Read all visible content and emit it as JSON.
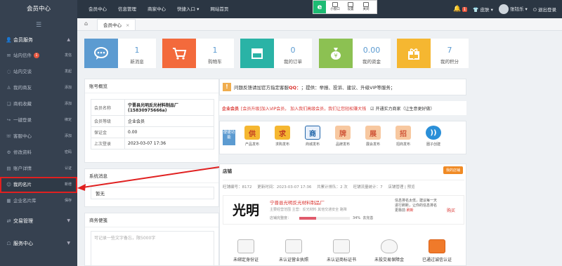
{
  "topbar": {
    "brand": "会员中心",
    "nav": [
      "会员中心",
      "信息管理",
      "商家中心",
      "快捷入口",
      "网站首页"
    ],
    "nav_dropdown_icon": "caret-down-icon",
    "floater": [
      "小窗口",
      "设置",
      "关闭"
    ],
    "notif_count": "1",
    "skin": "皮肤",
    "username": "张钰乐",
    "logout": "退出登录"
  },
  "sidebar": {
    "section": "会员服务",
    "items": [
      {
        "label": "站内信件",
        "badge": "1",
        "action": "发信"
      },
      {
        "label": "站内交谈",
        "action": "发起"
      },
      {
        "label": "我的商友",
        "action": "添加"
      },
      {
        "label": "商机收藏",
        "action": "添加"
      },
      {
        "label": "一键登录",
        "action": "绑定"
      },
      {
        "label": "客服中心",
        "action": "添加"
      },
      {
        "label": "修改资料",
        "action": "密码"
      },
      {
        "label": "账户详情",
        "action": "认证"
      },
      {
        "label": "我的名片",
        "action": "新增"
      },
      {
        "label": "企业名片库",
        "action": "保存"
      }
    ],
    "groups": [
      "交易管理",
      "服务中心"
    ]
  },
  "tabs": {
    "home_icon": "home-icon",
    "active": "会员中心"
  },
  "stats": [
    {
      "value": "1",
      "label": "新消息",
      "color": "#5c9bd1",
      "icon": "chat-icon"
    },
    {
      "value": "1",
      "label": "购物车",
      "color": "#f36a3c",
      "icon": "cart-icon"
    },
    {
      "value": "0",
      "label": "我的订单",
      "color": "#2ab3a6",
      "icon": "store-icon"
    },
    {
      "value": "0.00",
      "label": "我的资金",
      "color": "#8cc152",
      "icon": "money-icon"
    },
    {
      "value": "7",
      "label": "我的积分",
      "color": "#f5b731",
      "icon": "gift-icon"
    }
  ],
  "account": {
    "title": "账号概览",
    "rows": [
      {
        "k": "会员名称",
        "v": "宁晋县光明反光材料制品厂 (15830975666a)"
      },
      {
        "k": "会员等级",
        "v": "企业会员"
      },
      {
        "k": "保证金",
        "v": "0.00"
      },
      {
        "k": "上次登录",
        "v": "2023-03-07 17:36"
      }
    ]
  },
  "system": {
    "title": "系统消息",
    "empty": "暂无"
  },
  "memo": {
    "title": "商务便笺",
    "placeholder": "可记录一些文字备忘，限5000字"
  },
  "notice": {
    "pre": "问题反馈请加官方指定客服",
    "qq": "QQ：",
    "post": "；提供：举报、投诉、建议、升级VIP等服务；"
  },
  "upsell": {
    "title": "企业会员",
    "pre": "[会员升级]",
    "join": "加入VIP会员，",
    "mid": "加入我们高级会员，我们让您轻松赚大钱",
    "strength": "开通实力商家（让生意更好做）"
  },
  "tools": {
    "label": "便捷功能",
    "items": [
      {
        "char": "供",
        "label": "产品发布",
        "color": "#f5b731",
        "fg": "#c23b22"
      },
      {
        "char": "求",
        "label": "求购发布",
        "color": "#f5b731",
        "fg": "#c23b22"
      },
      {
        "char": "商",
        "label": "商城发布",
        "color": "#e8f0fb",
        "fg": "#2266aa"
      },
      {
        "char": "牌",
        "label": "品牌发布",
        "color": "#f7c8a0",
        "fg": "#d0573a"
      },
      {
        "char": "展",
        "label": "展会发布",
        "color": "#f7c8a0",
        "fg": "#d0573a"
      },
      {
        "char": "招",
        "label": "招商发布",
        "color": "#f7c8a0",
        "fg": "#d0573a"
      },
      {
        "char": "))",
        "label": "圈子创建",
        "color": "#2a8fd8",
        "fg": "#ffffff"
      }
    ]
  },
  "shop": {
    "title": "店铺",
    "edit_btn": "我的店铺",
    "meta": [
      "旺铺编号：8172",
      "更新时间：2023-03-07 17:36",
      "共累计排队：2 次",
      "旺铺流量统计：7",
      "店铺管理 | 预览"
    ],
    "logo_text": "光明",
    "name": "宁晋县光明反光材料制品厂",
    "business": "主要经营范围 主营：反光材料 其他交通安全 路障",
    "completeness_label": "店铺完整度：",
    "completeness_text": "34%",
    "completeness": 0.34,
    "complete_link": "去完善",
    "tip": "信息排名太低，建议每一天进行刷新，让你的信息排名更靠前",
    "refresh": "刷新",
    "buy": "购买",
    "certs": [
      "未绑定身份证",
      "未认证营业执照",
      "未认证商标证书",
      "未投交易保障金",
      "已通过诚信认证"
    ]
  }
}
